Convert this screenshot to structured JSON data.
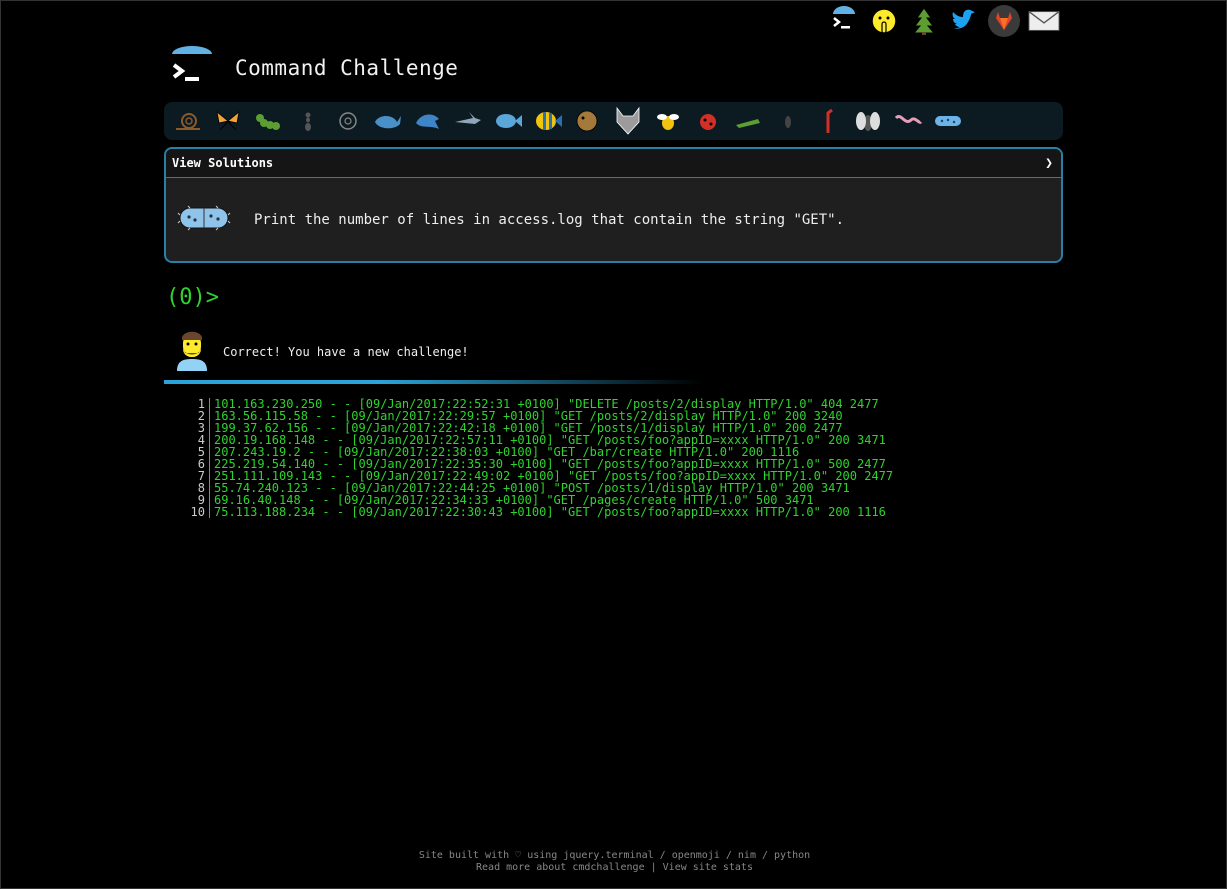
{
  "header": {
    "title": "Command Challenge"
  },
  "top_icons": [
    "terminal-icon",
    "shushing-face-icon",
    "tree-icon",
    "twitter-icon",
    "gitlab-icon",
    "mail-icon"
  ],
  "creatures": [
    "snail-icon",
    "butterfly-icon",
    "caterpillar-icon",
    "ant-icon",
    "shell-icon",
    "whale-icon",
    "dolphin-icon",
    "shark-icon",
    "fish-icon",
    "tropical-fish-icon",
    "blowfish-icon",
    "wolf-icon",
    "bee-icon",
    "ladybug-icon",
    "cricket-icon",
    "spider-icon",
    "scorpion-icon",
    "fly-icon",
    "worm-icon",
    "microbe-icon"
  ],
  "panel": {
    "view_solutions": "View Solutions",
    "chevron": "❯",
    "task": "Print the number of lines in access.log that contain the string \"GET\"."
  },
  "prompt": "(0)>",
  "message": "Correct! You have a new challenge!",
  "log": {
    "line_numbers": [
      "1",
      "2",
      "3",
      "4",
      "5",
      "6",
      "7",
      "8",
      "9",
      "10"
    ],
    "lines": [
      "101.163.230.250 - - [09/Jan/2017:22:52:31 +0100] \"DELETE /posts/2/display HTTP/1.0\" 404 2477",
      "163.56.115.58 - - [09/Jan/2017:22:29:57 +0100] \"GET /posts/2/display HTTP/1.0\" 200 3240",
      "199.37.62.156 - - [09/Jan/2017:22:42:18 +0100] \"GET /posts/1/display HTTP/1.0\" 200 2477",
      "200.19.168.148 - - [09/Jan/2017:22:57:11 +0100] \"GET /posts/foo?appID=xxxx HTTP/1.0\" 200 3471",
      "207.243.19.2 - - [09/Jan/2017:22:38:03 +0100] \"GET /bar/create HTTP/1.0\" 200 1116",
      "225.219.54.140 - - [09/Jan/2017:22:35:30 +0100] \"GET /posts/foo?appID=xxxx HTTP/1.0\" 500 2477",
      "251.111.109.143 - - [09/Jan/2017:22:49:02 +0100] \"GET /posts/foo?appID=xxxx HTTP/1.0\" 200 2477",
      "55.74.240.123 - - [09/Jan/2017:22:44:25 +0100] \"POST /posts/1/display HTTP/1.0\" 200 3471",
      "69.16.40.148 - - [09/Jan/2017:22:34:33 +0100] \"GET /pages/create HTTP/1.0\" 500 3471",
      "75.113.188.234 - - [09/Jan/2017:22:30:43 +0100] \"GET /posts/foo?appID=xxxx HTTP/1.0\" 200 1116"
    ]
  },
  "footer": {
    "line1": "Site built with ♡ using jquery.terminal / openmoji / nim / python",
    "line2": "Read more about cmdchallenge | View site stats"
  },
  "colors": {
    "accent": "#2b7ea6",
    "terminal_green": "#2fd32f"
  }
}
